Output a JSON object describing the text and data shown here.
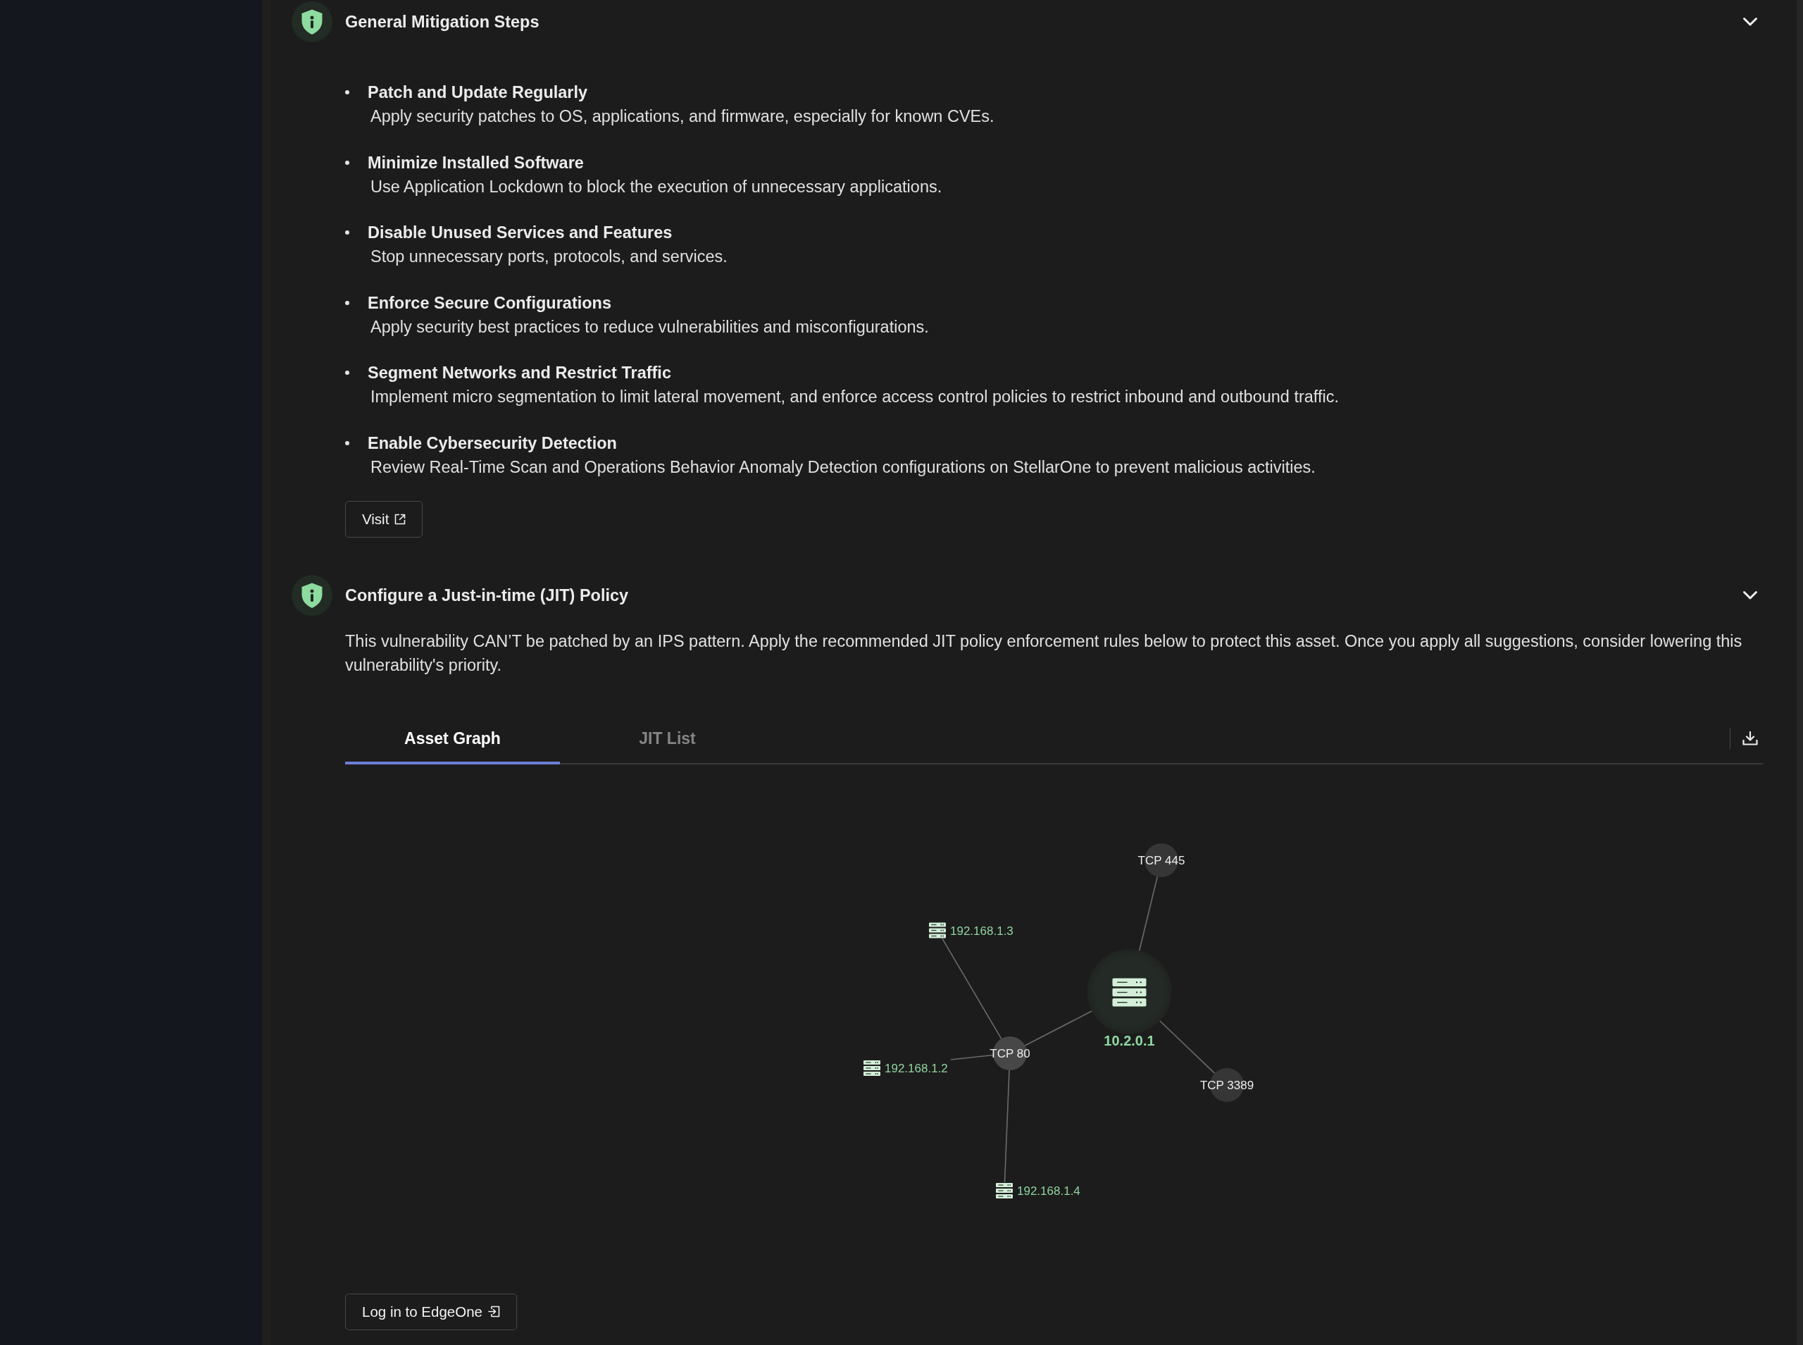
{
  "sections": [
    {
      "kind": "steps",
      "title": "General Mitigation Steps",
      "expanded": true,
      "steps": [
        {
          "title": "Patch and Update Regularly",
          "description": "Apply security patches to OS, applications, and firmware, especially for known CVEs."
        },
        {
          "title": "Minimize Installed Software",
          "description": "Use Application Lockdown to block the execution of unnecessary applications."
        },
        {
          "title": "Disable Unused Services and Features",
          "description": "Stop unnecessary ports, protocols, and services."
        },
        {
          "title": "Enforce Secure Configurations",
          "description": "Apply security best practices to reduce vulnerabilities and misconfigurations."
        },
        {
          "title": "Segment Networks and Restrict Traffic",
          "description": "Implement micro segmentation to limit lateral movement, and enforce access control policies to restrict inbound and outbound traffic."
        },
        {
          "title": "Enable Cybersecurity Detection",
          "description": "Review Real-Time Scan and Operations Behavior Anomaly Detection configurations on StellarOne to prevent malicious activities."
        }
      ],
      "button": "Visit"
    },
    {
      "kind": "policy",
      "title": "Configure a Just-in-time (JIT) Policy",
      "expanded": true,
      "description": "This vulnerability CAN’T be patched by an IPS pattern. Apply the recommended JIT policy enforcement rules below to protect this asset. Once you apply all suggestions, consider lowering this vulnerability's priority.",
      "tabs": [
        {
          "label": "Asset Graph",
          "selected": true
        },
        {
          "label": "JIT List",
          "selected": false
        }
      ],
      "graph": {
        "asset": "10.2.0.1",
        "ports": [
          {
            "label": "TCP 445"
          },
          {
            "label": "TCP 80",
            "hosts": [
              "192.168.1.3",
              "192.168.1.2",
              "192.168.1.4"
            ]
          },
          {
            "label": "TCP 3389"
          }
        ]
      },
      "button": "Log in to EdgeOne"
    }
  ]
}
